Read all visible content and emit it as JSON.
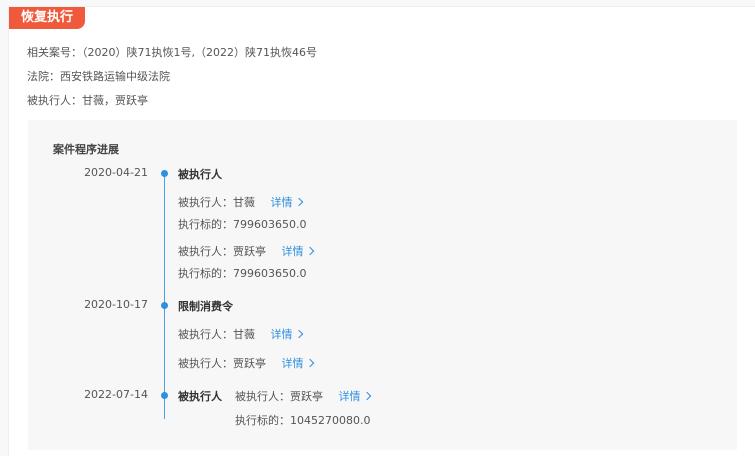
{
  "tag": "恢复执行",
  "info": [
    "相关案号：（2020）陕71执恢1号,（2022）陕71执恢46号",
    "法院：西安铁路运输中级法院",
    "被执行人：甘薇，贾跃亭"
  ],
  "panel_title": "案件程序进展",
  "detail_label": "详情",
  "events": [
    {
      "date": "2020-04-21",
      "title": "被执行人",
      "rows": [
        {
          "label": "被执行人：",
          "value": "甘薇"
        },
        {
          "label": "执行标的：",
          "value": "799603650.0"
        },
        {
          "label": "被执行人：",
          "value": "贾跃亭"
        },
        {
          "label": "执行标的：",
          "value": "799603650.0"
        }
      ]
    },
    {
      "date": "2020-10-17",
      "title": "限制消费令",
      "rows": [
        {
          "label": "被执行人：",
          "value": "甘薇"
        },
        {
          "label": "被执行人：",
          "value": "贾跃亭"
        }
      ]
    },
    {
      "date": "2022-07-14",
      "title": "被执行人",
      "rows": [
        {
          "label": "被执行人：",
          "value": "贾跃亭"
        },
        {
          "label": "执行标的：",
          "value": "1045270080.0"
        }
      ]
    }
  ]
}
